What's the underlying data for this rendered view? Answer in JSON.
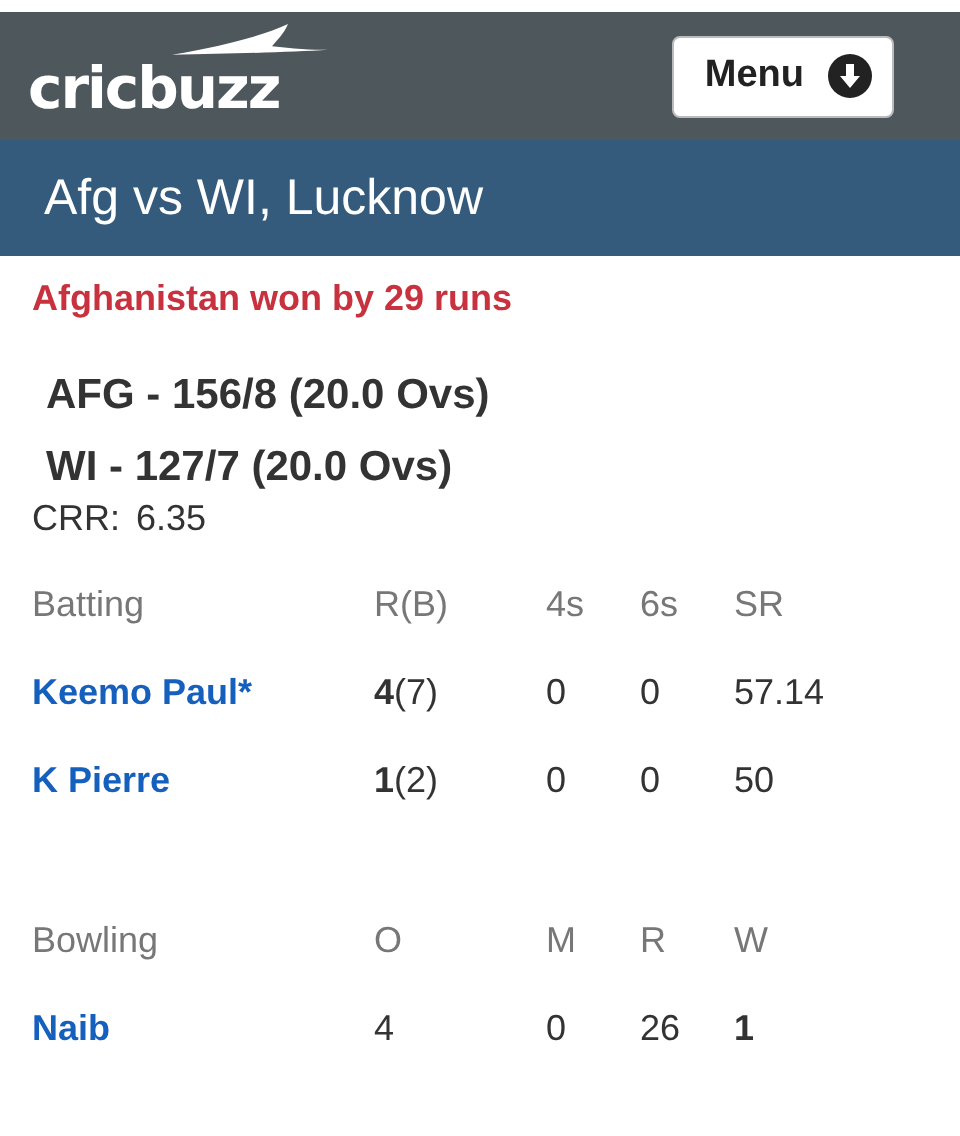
{
  "header": {
    "logo": "cricbuzz",
    "menu_button": "Menu"
  },
  "title": "Afg vs WI, Lucknow",
  "result": "Afghanistan won by 29 runs",
  "scores": [
    "AFG - 156/8 (20.0 Ovs)",
    "WI - 127/7 (20.0 Ovs)"
  ],
  "crr": {
    "label": "CRR:",
    "value": "6.35"
  },
  "batting": {
    "columns": [
      "Batting",
      "R(B)",
      "4s",
      "6s",
      "SR"
    ],
    "rows": [
      {
        "cells": [
          "Keemo Paul*",
          "**4**(7)",
          "0",
          "0",
          "57.14"
        ]
      },
      {
        "cells": [
          "K Pierre",
          "**1**(2)",
          "0",
          "0",
          "50"
        ]
      }
    ]
  },
  "bowling": {
    "columns": [
      "Bowling",
      "O",
      "M",
      "R",
      "W"
    ],
    "rows": [
      {
        "cells": [
          "Naib",
          "4",
          "0",
          "26",
          "1"
        ]
      }
    ]
  }
}
